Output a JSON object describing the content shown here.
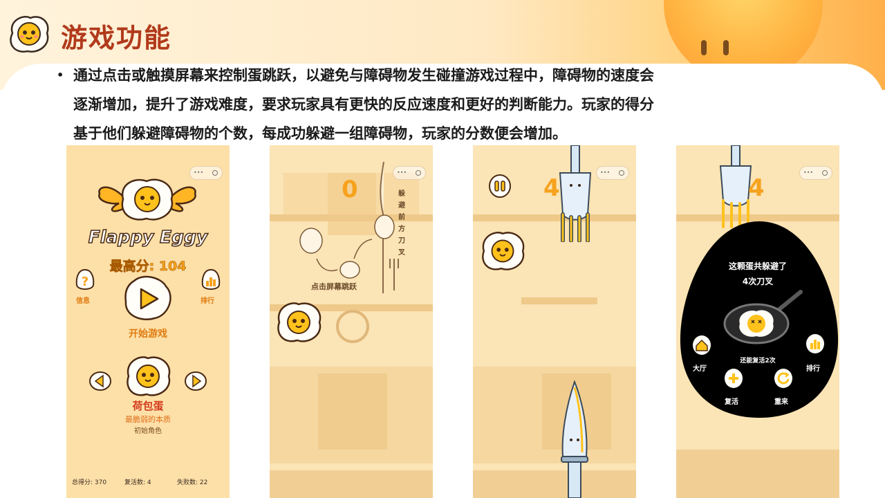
{
  "slide": {
    "title": "游戏功能",
    "description_lines": [
      "通过点击或触摸屏幕来控制蛋跳跃，以避免与障碍物发生碰撞游戏过程中，障碍物的速度会",
      "逐渐增加，提升了游戏难度，要求玩家具有更快的反应速度和更好的判断能力。玩家的得分",
      "基于他们躲避障碍物的个数，每成功躲避一组障碍物，玩家的分数便会增加。"
    ],
    "bullet": "•"
  },
  "screen1": {
    "game_title": "Flappy Eggy",
    "high_score": "最高分: 104",
    "info_label": "信息",
    "rank_label": "排行",
    "start_label": "开始游戏",
    "character_name": "荷包蛋",
    "character_desc": "最脆弱的本质",
    "character_tag": "初始角色",
    "footer_total": "总得分: 370",
    "footer_revive": "复活数: 4",
    "footer_fail": "失败数: 22"
  },
  "screen2": {
    "score": "0",
    "tap_hint": "点击屏幕跳跃",
    "avoid_hint": "躲避前方刀叉"
  },
  "screen3": {
    "score": "4"
  },
  "screen4": {
    "score": "4",
    "result_line1": "这颗蛋共躲避了",
    "result_line2": "4次刀叉",
    "revive_remaining": "还能复活2次",
    "lobby_label": "大厅",
    "rank_label": "排行",
    "revive_label": "复活",
    "restart_label": "重来"
  },
  "colors": {
    "title_red": "#b13a1b",
    "score_orange": "#f6a21e",
    "screen_bg": "#fbe4b5",
    "egg_yolk": "#ffc21c",
    "dark_panel": "#000000"
  }
}
